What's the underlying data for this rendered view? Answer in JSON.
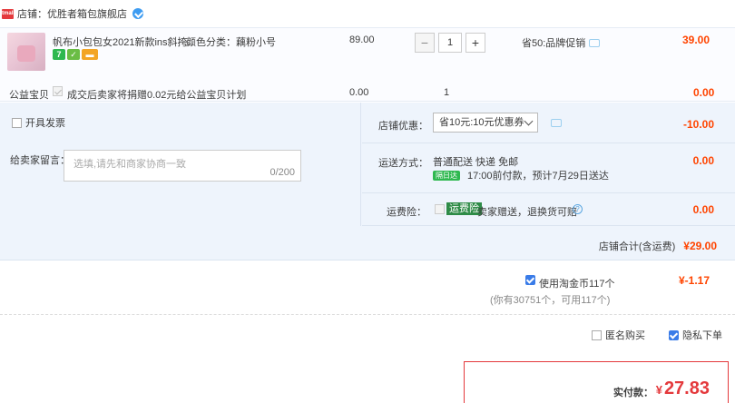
{
  "shop": {
    "label": "店铺：优胜者箱包旗舰店",
    "logo_text": "tmall"
  },
  "item": {
    "title": "帆布小包包女2021新款ins斜挎...",
    "attr": "颜色分类：藕粉小号",
    "price": "89.00",
    "quantity": "1",
    "qty_minus": "−",
    "qty_plus": "+",
    "promo": "省50:品牌促销",
    "subtotal": "39.00",
    "service_icons": [
      "7",
      "✓",
      "▬"
    ]
  },
  "charity": {
    "label": "公益宝贝",
    "text": "成交后卖家将捐赠0.02元给公益宝贝计划",
    "price": "0.00",
    "qty": "1",
    "total": "0.00"
  },
  "invoice": {
    "label": "开具发票"
  },
  "message": {
    "label": "给卖家留言：",
    "placeholder": "选填,请先和商家协商一致",
    "counter": "0/200"
  },
  "discount": {
    "label": "店铺优惠：",
    "selected": "省10元:10元优惠券",
    "amount": "-10.00"
  },
  "shipping": {
    "label": "运送方式：",
    "method": "普通配送 快递 免邮",
    "badge": "隔日达",
    "eta": "17:00前付款，预计7月29日送达",
    "amount": "0.00"
  },
  "insurance": {
    "label": "运费险：",
    "tag": "运费险",
    "text": "卖家赠送，退换货可赔",
    "help": "?",
    "amount": "0.00"
  },
  "shop_total": {
    "label": "店铺合计(含运费)",
    "amount": "¥29.00"
  },
  "coins": {
    "label": "使用淘金币117个",
    "sub": "(你有30751个，可用117个)",
    "amount": "¥-1.17"
  },
  "options": {
    "anonymous": "匿名购买",
    "hide_order": "隐私下单"
  },
  "payment": {
    "label": "实付款：",
    "currency": "¥",
    "amount": "27.83"
  },
  "colors": {
    "accent": "#ff4400",
    "panel": "#eef4fc",
    "checkbox": "#3a7ce8"
  }
}
